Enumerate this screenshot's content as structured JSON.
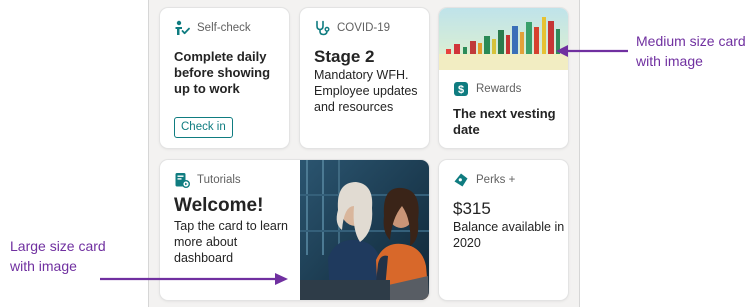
{
  "cards": {
    "self_check": {
      "category": "Self-check",
      "title": "Complete daily before showing up to work",
      "action_label": "Check in"
    },
    "covid": {
      "category": "COVID-19",
      "title": "Stage 2",
      "body": "Mandatory WFH. Employee updates and resources"
    },
    "rewards": {
      "category": "Rewards",
      "title": "The next vesting date"
    },
    "tutorials": {
      "category": "Tutorials",
      "title": "Welcome!",
      "body": "Tap the card to learn more about dashboard"
    },
    "perks": {
      "category": "Perks +",
      "title": "$315",
      "body": "Balance available in 2020"
    }
  },
  "annotations": {
    "medium": "Medium size card with image",
    "large": "Large size card with image"
  },
  "colors": {
    "accent": "#0f7c80",
    "annotation": "#7030a0",
    "arrow": "#7030a0"
  },
  "icons": {
    "self_check": "person-check-icon",
    "covid": "stethoscope-icon",
    "rewards": "dollar-sign-icon",
    "tutorials": "tutorial-book-icon",
    "perks": "perks-gift-icon"
  }
}
